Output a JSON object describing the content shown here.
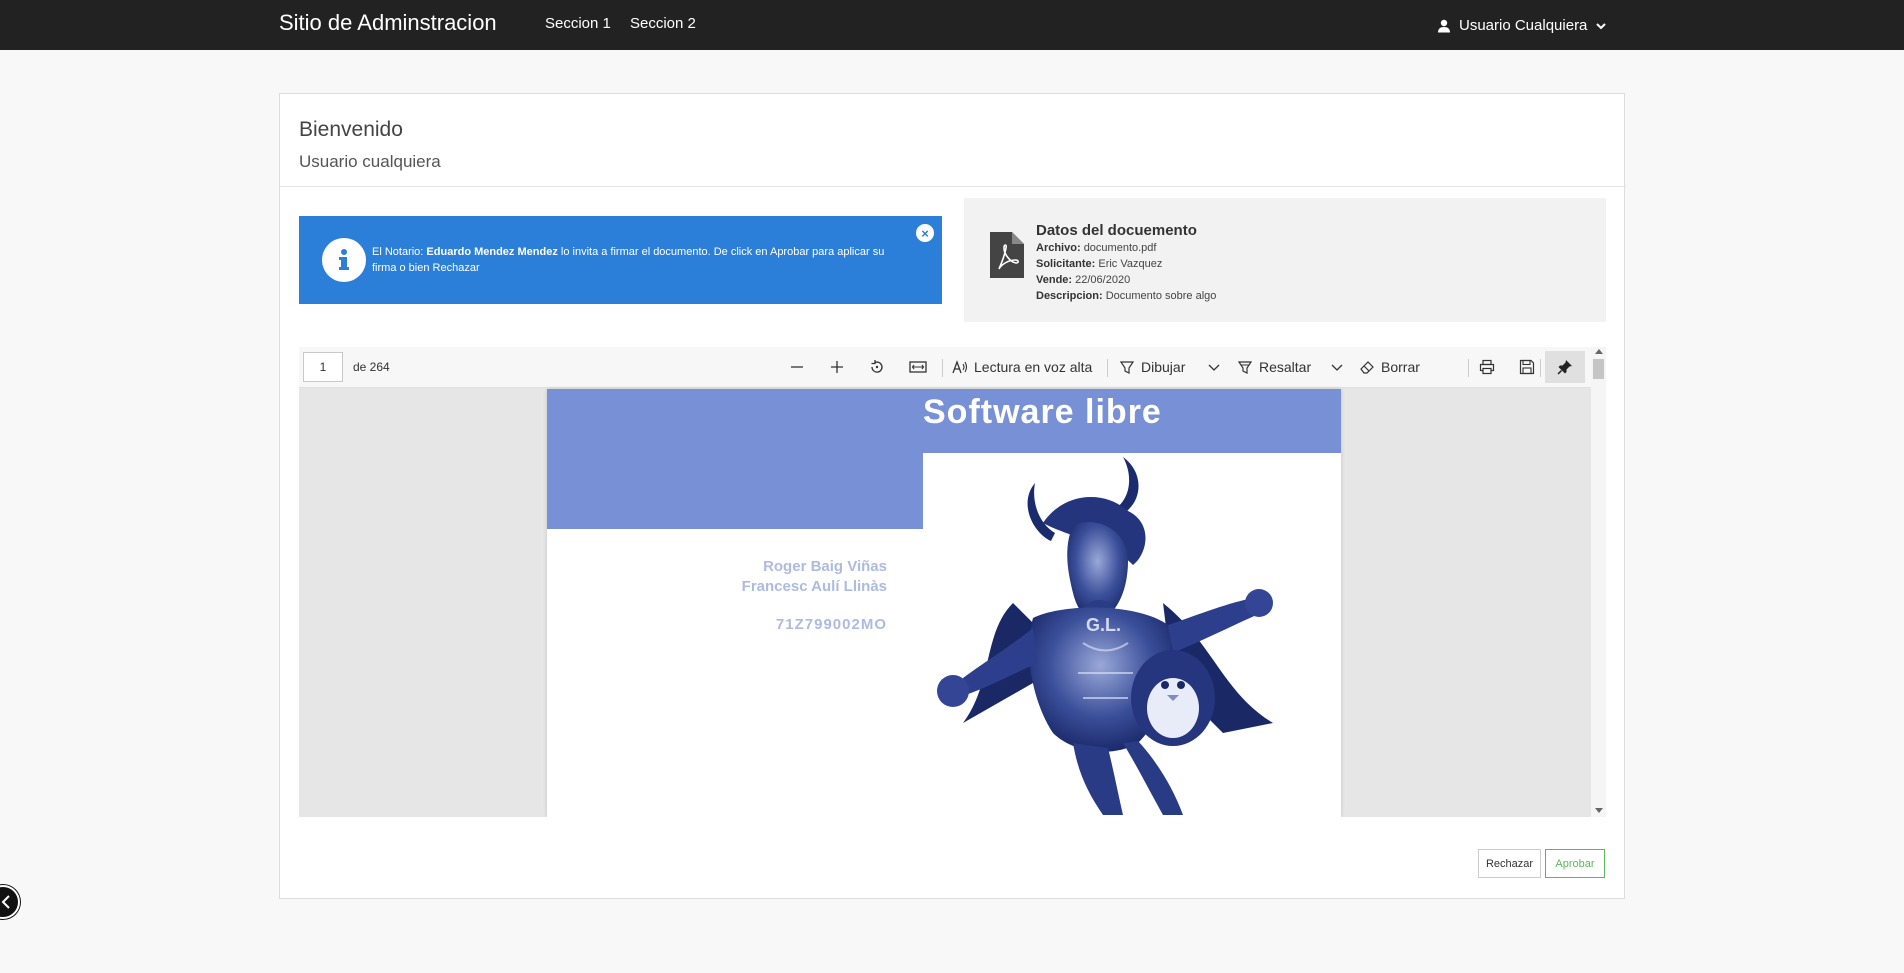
{
  "navbar": {
    "brand": "Sitio de Adminstracion",
    "links": [
      "Seccion 1",
      "Seccion 2"
    ],
    "user": "Usuario Cualquiera",
    "user_icon": "user-icon",
    "caret_icon": "chevron-down-icon"
  },
  "header": {
    "title": "Bienvenido",
    "subtitle": "Usuario cualquiera"
  },
  "alert": {
    "icon": "info-icon",
    "prefix": "El Notario: ",
    "notary": "Eduardo Mendez Mendez",
    "message": " lo invita a firmar el documento. De click en Aprobar para aplicar su firma o bien Rechazar",
    "close": "×",
    "color": "#2b7fd9"
  },
  "document": {
    "icon": "pdf-file-icon",
    "title": "Datos del docuemento",
    "fields": [
      {
        "label": "Archivo:",
        "value": "documento.pdf"
      },
      {
        "label": "Solicitante:",
        "value": "Eric Vazquez"
      },
      {
        "label": "Vende:",
        "value": "22/06/2020"
      },
      {
        "label": "Descripcion:",
        "value": "Documento sobre algo"
      }
    ]
  },
  "viewer": {
    "page": "1",
    "total": "de 264",
    "read_aloud": "Lectura en voz alta",
    "draw": "Dibujar",
    "highlight": "Resaltar",
    "erase": "Borrar"
  },
  "pdf": {
    "title": "Software libre",
    "authors": [
      "Roger Baig Viñas",
      "Francesc Aulí Llinàs"
    ],
    "code": "71Z799002MO",
    "band_color": "#7891d6"
  },
  "actions": {
    "reject": "Rechazar",
    "approve": "Aprobar",
    "approve_color": "#5cb85c"
  }
}
